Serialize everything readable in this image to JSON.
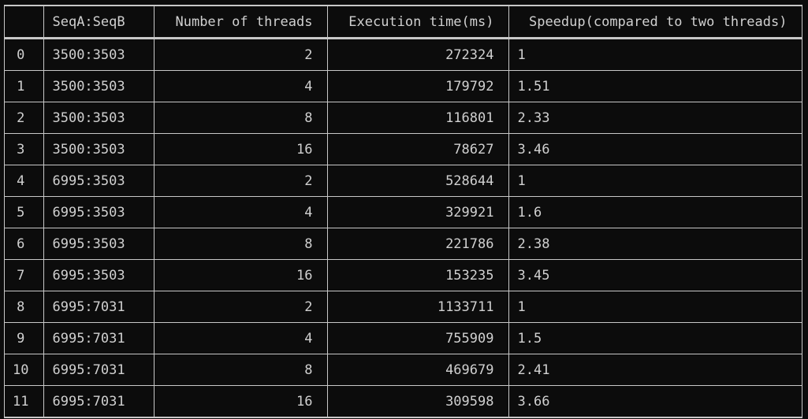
{
  "table": {
    "headers": {
      "index": "",
      "seq": "SeqA:SeqB",
      "threads": "Number of threads",
      "exec": "Execution time(ms)",
      "speedup": "Speedup(compared to two threads)"
    },
    "rows": [
      {
        "index": "0",
        "seq": "3500:3503",
        "threads": "2",
        "exec": "272324",
        "speedup": "1"
      },
      {
        "index": "1",
        "seq": "3500:3503",
        "threads": "4",
        "exec": "179792",
        "speedup": "1.51"
      },
      {
        "index": "2",
        "seq": "3500:3503",
        "threads": "8",
        "exec": "116801",
        "speedup": "2.33"
      },
      {
        "index": "3",
        "seq": "3500:3503",
        "threads": "16",
        "exec": "78627",
        "speedup": "3.46"
      },
      {
        "index": "4",
        "seq": "6995:3503",
        "threads": "2",
        "exec": "528644",
        "speedup": "1"
      },
      {
        "index": "5",
        "seq": "6995:3503",
        "threads": "4",
        "exec": "329921",
        "speedup": "1.6"
      },
      {
        "index": "6",
        "seq": "6995:3503",
        "threads": "8",
        "exec": "221786",
        "speedup": "2.38"
      },
      {
        "index": "7",
        "seq": "6995:3503",
        "threads": "16",
        "exec": "153235",
        "speedup": "3.45"
      },
      {
        "index": "8",
        "seq": "6995:7031",
        "threads": "2",
        "exec": "1133711",
        "speedup": "1"
      },
      {
        "index": "9",
        "seq": "6995:7031",
        "threads": "4",
        "exec": "755909",
        "speedup": "1.5"
      },
      {
        "index": "10",
        "seq": "6995:7031",
        "threads": "8",
        "exec": "469679",
        "speedup": "2.41"
      },
      {
        "index": "11",
        "seq": "6995:7031",
        "threads": "16",
        "exec": "309598",
        "speedup": "3.66"
      }
    ]
  },
  "colors": {
    "background": "#0c0c0c",
    "text": "#d0d0d0",
    "grid": "#c8c8c8"
  }
}
